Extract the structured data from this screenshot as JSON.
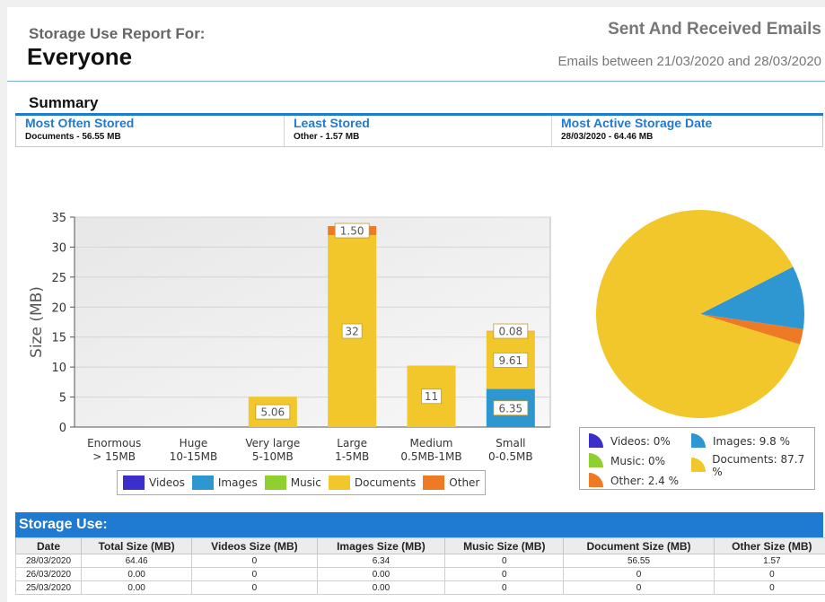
{
  "header": {
    "subtitle": "Storage Use Report For:",
    "title": "Everyone",
    "report_name": "Sent And Received Emails",
    "date_range": "Emails between 21/03/2020 and 28/03/2020"
  },
  "summary": {
    "title": "Summary",
    "cells": [
      {
        "label": "Most Often Stored",
        "value": "Documents - 56.55 MB"
      },
      {
        "label": "Least Stored",
        "value": "Other - 1.57 MB"
      },
      {
        "label": "Most Active Storage Date",
        "value": "28/03/2020 - 64.46 MB"
      }
    ]
  },
  "colors": {
    "videos": "#3b2fc9",
    "images": "#2e96d1",
    "music": "#8fcf2e",
    "documents": "#f1c72b",
    "other": "#ee7a25",
    "accent": "#1f7ad1"
  },
  "chart_data": [
    {
      "type": "bar",
      "stacked": true,
      "ylabel": "Size (MB)",
      "ylim": [
        0,
        35
      ],
      "yticks": [
        0,
        5,
        10,
        15,
        20,
        25,
        30,
        35
      ],
      "categories": [
        "Enormous\n> 15MB",
        "Huge\n10-15MB",
        "Very large\n5-10MB",
        "Large\n1-5MB",
        "Medium\n0.5MB-1MB",
        "Small\n0-0.5MB"
      ],
      "series": [
        {
          "name": "Videos",
          "values": [
            0,
            0,
            0,
            0,
            0,
            0
          ]
        },
        {
          "name": "Images",
          "values": [
            0,
            0,
            0,
            0,
            0,
            6.35
          ]
        },
        {
          "name": "Music",
          "values": [
            0,
            0,
            0,
            0,
            0,
            0
          ]
        },
        {
          "name": "Documents",
          "values": [
            0,
            0,
            5.06,
            32,
            10.25,
            9.61
          ]
        },
        {
          "name": "Other",
          "values": [
            0,
            0,
            0,
            1.5,
            0,
            0.08
          ]
        }
      ],
      "data_labels": [
        {
          "category": 2,
          "series": "Documents",
          "text": "5.06"
        },
        {
          "category": 3,
          "series": "Documents",
          "text": "32"
        },
        {
          "category": 3,
          "series": "Other",
          "text": "1.50"
        },
        {
          "category": 4,
          "series": "Documents",
          "text": "11"
        },
        {
          "category": 5,
          "series": "Images",
          "text": "6.35"
        },
        {
          "category": 5,
          "series": "Documents",
          "text": "9.61"
        },
        {
          "category": 5,
          "series": "Other",
          "text": "0.08"
        }
      ],
      "legend": [
        "Videos",
        "Images",
        "Music",
        "Documents",
        "Other"
      ],
      "legend_position": "bottom",
      "grid": true
    },
    {
      "type": "pie",
      "slices": [
        {
          "name": "Videos",
          "value": 0,
          "label": "Videos: 0%"
        },
        {
          "name": "Images",
          "value": 9.8,
          "label": "Images: 9.8 %"
        },
        {
          "name": "Music",
          "value": 0,
          "label": "Music: 0%"
        },
        {
          "name": "Documents",
          "value": 87.7,
          "label": "Documents: 87.7 %"
        },
        {
          "name": "Other",
          "value": 2.4,
          "label": "Other: 2.4 %"
        }
      ],
      "legend_position": "bottom"
    }
  ],
  "storage_use": {
    "title": "Storage Use:",
    "columns": [
      "Date",
      "Total Size (MB)",
      "Videos Size (MB)",
      "Images Size (MB)",
      "Music Size (MB)",
      "Document Size (MB)",
      "Other Size (MB)"
    ],
    "rows": [
      [
        "28/03/2020",
        "64.46",
        "0",
        "6.34",
        "0",
        "56.55",
        "1.57"
      ],
      [
        "26/03/2020",
        "0.00",
        "0",
        "0.00",
        "0",
        "0",
        "0"
      ],
      [
        "25/03/2020",
        "0.00",
        "0",
        "0.00",
        "0",
        "0",
        "0"
      ]
    ]
  }
}
